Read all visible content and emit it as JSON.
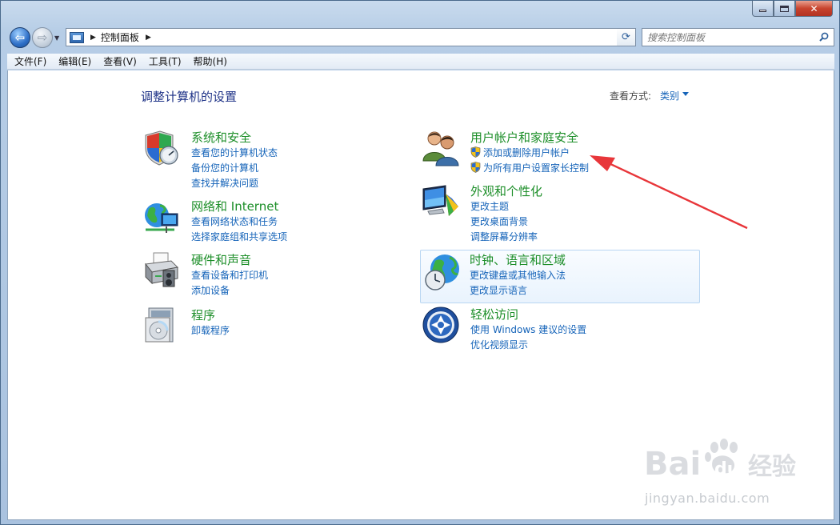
{
  "window": {
    "close_glyph": "✕"
  },
  "navbar": {
    "breadcrumb": "控制面板",
    "search_placeholder": "搜索控制面板"
  },
  "menu": [
    {
      "label": "文件(F)"
    },
    {
      "label": "编辑(E)"
    },
    {
      "label": "查看(V)"
    },
    {
      "label": "工具(T)"
    },
    {
      "label": "帮助(H)"
    }
  ],
  "main": {
    "title": "调整计算机的设置",
    "view_by_label": "查看方式:",
    "view_by_value": "类别"
  },
  "categories": [
    {
      "icon": "security-shield-icon",
      "title": "系统和安全",
      "links": [
        "查看您的计算机状态",
        "备份您的计算机",
        "查找并解决问题"
      ]
    },
    {
      "icon": "network-globe-icon",
      "title": "网络和 Internet",
      "links": [
        "查看网络状态和任务",
        "选择家庭组和共享选项"
      ]
    },
    {
      "icon": "hardware-printer-icon",
      "title": "硬件和声音",
      "links": [
        "查看设备和打印机",
        "添加设备"
      ]
    },
    {
      "icon": "programs-disc-icon",
      "title": "程序",
      "links": [
        "卸载程序"
      ]
    },
    {
      "icon": "users-icon",
      "title": "用户帐户和家庭安全",
      "links": [
        "添加或删除用户帐户",
        "为所有用户设置家长控制"
      ]
    },
    {
      "icon": "appearance-monitor-icon",
      "title": "外观和个性化",
      "links": [
        "更改主题",
        "更改桌面背景",
        "调整屏幕分辨率"
      ]
    },
    {
      "icon": "clock-globe-icon",
      "title": "时钟、语言和区域",
      "links": [
        "更改键盘或其他输入法",
        "更改显示语言"
      ]
    },
    {
      "icon": "ease-of-access-icon",
      "title": "轻松访问",
      "links": [
        "使用 Windows 建议的设置",
        "优化视频显示"
      ]
    }
  ],
  "watermark": {
    "url": "jingyan.baidu.com"
  },
  "colors": {
    "title_blue": "#1e3287",
    "category_green": "#1e8f2a",
    "link_blue": "#1664b9",
    "annotation_red": "#e8363a"
  }
}
